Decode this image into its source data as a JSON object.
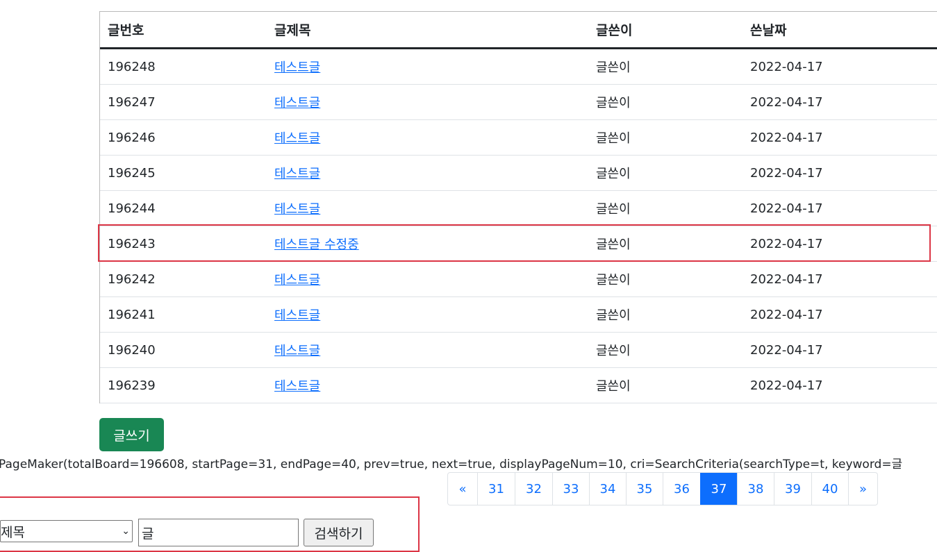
{
  "board": {
    "headers": {
      "no": "글번호",
      "title": "글제목",
      "writer": "글쓴이",
      "date": "쓴날짜"
    },
    "rows": [
      {
        "no": "196248",
        "title": "테스트글",
        "writer": "글쓴이",
        "date": "2022-04-17"
      },
      {
        "no": "196247",
        "title": "테스트글",
        "writer": "글쓴이",
        "date": "2022-04-17"
      },
      {
        "no": "196246",
        "title": "테스트글",
        "writer": "글쓴이",
        "date": "2022-04-17"
      },
      {
        "no": "196245",
        "title": "테스트글",
        "writer": "글쓴이",
        "date": "2022-04-17"
      },
      {
        "no": "196244",
        "title": "테스트글",
        "writer": "글쓴이",
        "date": "2022-04-17"
      },
      {
        "no": "196243",
        "title": "테스트글 수정중",
        "writer": "글쓴이",
        "date": "2022-04-17"
      },
      {
        "no": "196242",
        "title": "테스트글",
        "writer": "글쓴이",
        "date": "2022-04-17"
      },
      {
        "no": "196241",
        "title": "테스트글",
        "writer": "글쓴이",
        "date": "2022-04-17"
      },
      {
        "no": "196240",
        "title": "테스트글",
        "writer": "글쓴이",
        "date": "2022-04-17"
      },
      {
        "no": "196239",
        "title": "테스트글",
        "writer": "글쓴이",
        "date": "2022-04-17"
      }
    ]
  },
  "write_button_label": "글쓰기",
  "debug_text": "PageMaker(totalBoard=196608, startPage=31, endPage=40, prev=true, next=true, displayPageNum=10, cri=SearchCriteria(searchType=t, keyword=글",
  "pagination": {
    "prev": "«",
    "pages": [
      "31",
      "32",
      "33",
      "34",
      "35",
      "36",
      "37",
      "38",
      "39",
      "40"
    ],
    "active": "37",
    "next": "»"
  },
  "search": {
    "type_selected": "제목",
    "keyword_value": "글",
    "button_label": "검색하기"
  },
  "colors": {
    "link": "#0d6efd",
    "write_button": "#198754",
    "highlight": "#dc3545",
    "active_page": "#0d6efd"
  }
}
